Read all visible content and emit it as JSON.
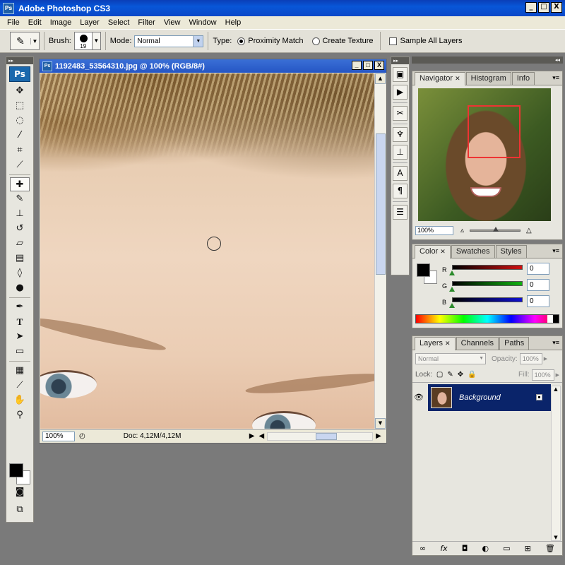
{
  "app": {
    "title": "Adobe Photoshop CS3",
    "badge": "Ps"
  },
  "window_controls": {
    "minimize": "_",
    "maximize": "□",
    "close": "X"
  },
  "menu": [
    "File",
    "Edit",
    "Image",
    "Layer",
    "Select",
    "Filter",
    "View",
    "Window",
    "Help"
  ],
  "options": {
    "brush_label": "Brush:",
    "brush_size": "19",
    "mode_label": "Mode:",
    "mode_value": "Normal",
    "type_label": "Type:",
    "proximity_label": "Proximity Match",
    "texture_label": "Create Texture",
    "sample_label": "Sample All Layers",
    "type_selected": "Proximity Match"
  },
  "toolbox": {
    "badge": "Ps"
  },
  "document": {
    "title": "1192483_53564310.jpg @ 100% (RGB/8#)",
    "zoom": "100%",
    "doc_info": "Doc: 4,12M/4,12M"
  },
  "navigator_panel": {
    "tabs": [
      "Navigator",
      "Histogram",
      "Info"
    ],
    "zoom": "100%"
  },
  "color_panel": {
    "tabs": [
      "Color",
      "Swatches",
      "Styles"
    ],
    "channels": [
      {
        "label": "R",
        "value": "0",
        "color": "#d01010"
      },
      {
        "label": "G",
        "value": "0",
        "color": "#10b010"
      },
      {
        "label": "B",
        "value": "0",
        "color": "#1010d0"
      }
    ]
  },
  "layers_panel": {
    "tabs": [
      "Layers",
      "Channels",
      "Paths"
    ],
    "blend_mode": "Normal",
    "opacity_label": "Opacity:",
    "opacity": "100%",
    "lock_label": "Lock:",
    "fill_label": "Fill:",
    "fill": "100%",
    "layers": [
      {
        "name": "Background",
        "visible": true,
        "locked": true
      }
    ]
  },
  "colors": {
    "title_blue": "#0a48c8",
    "layer_selected": "#0a246a",
    "nav_box": "#e33333"
  }
}
